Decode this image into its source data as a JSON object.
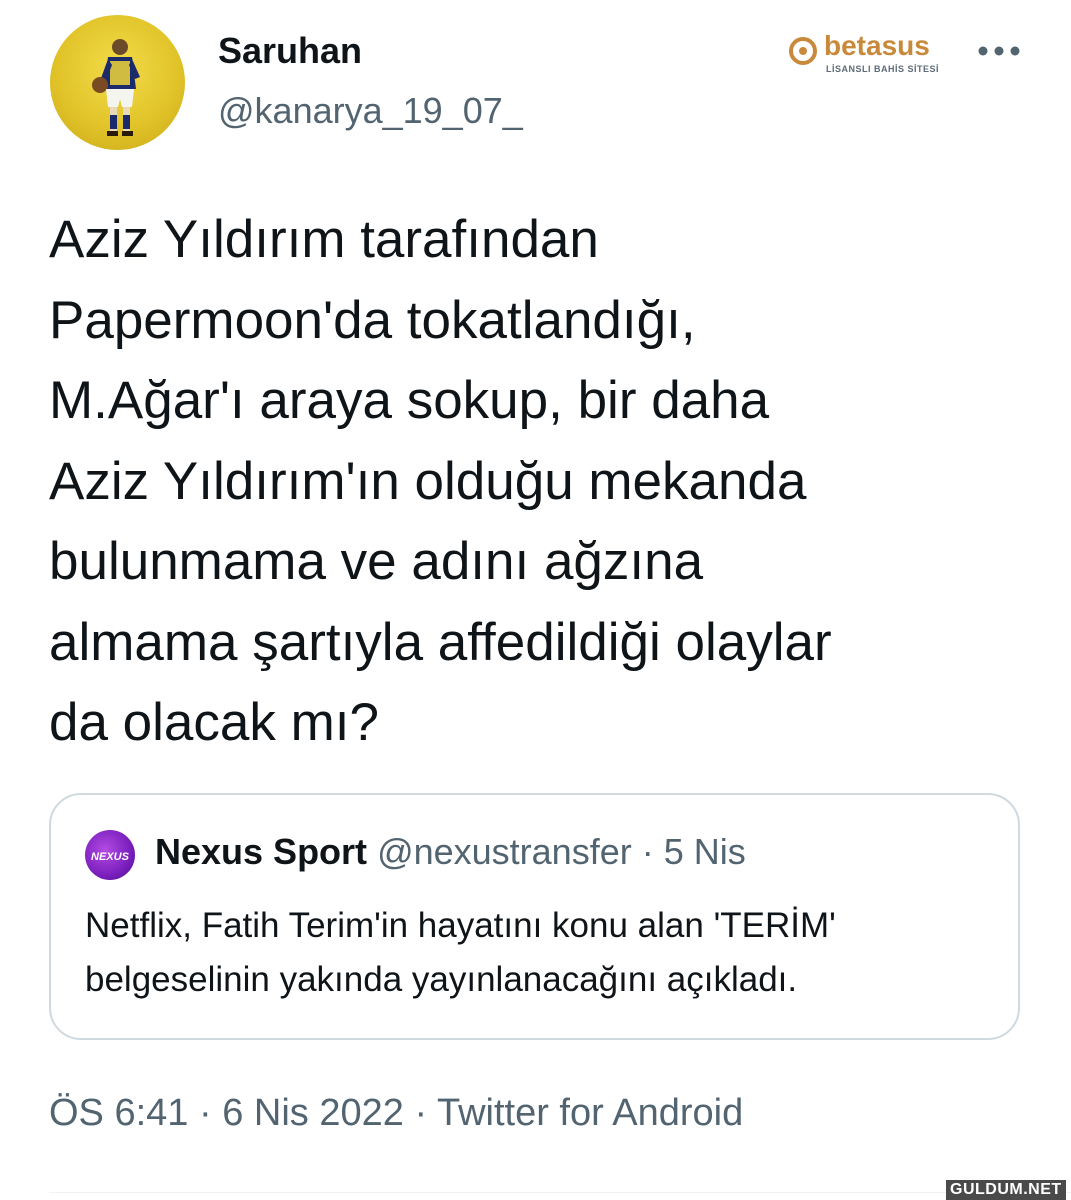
{
  "tweet": {
    "author": {
      "display_name": "Saruhan",
      "handle": "@kanarya_19_07_",
      "avatar_icon": "profile-avatar"
    },
    "text": "Aziz Yıldırım tarafından\nPapermoon'da tokatlandığı,\nM.Ağar'ı araya sokup, bir daha\nAziz Yıldırım'ın olduğu mekanda\nbulunmama ve adını ağzına\nalmama şartıyla affedildiği olaylar\nda olacak mı?",
    "more_icon": "more-horizontal-icon"
  },
  "brand": {
    "name": "betasus",
    "tagline": "LİSANSLI BAHİS SİTESİ",
    "color": "#c88a3a"
  },
  "quote": {
    "display_name": "Nexus Sport",
    "handle": "@nexustransfer",
    "separator": "·",
    "date": "5 Nis",
    "avatar_label": "NEXUS",
    "text": "Netflix, Fatih Terim'in hayatını konu alan 'TERİM' belgeselinin yakında yayınlanacağını açıkladı."
  },
  "meta": {
    "time": "ÖS 6:41",
    "date": "6 Nis 2022",
    "source": "Twitter for Android",
    "separator": "·"
  },
  "watermark": "GULDUM.NET",
  "colors": {
    "text": "#0f1419",
    "secondary": "#536471",
    "border": "#cfd9de"
  }
}
